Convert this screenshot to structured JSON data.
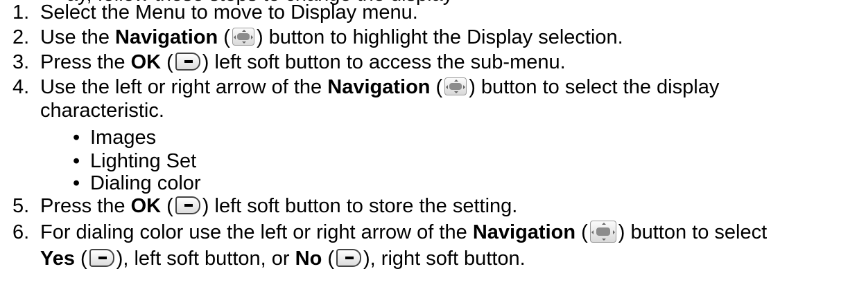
{
  "header_fragment": "ay, follow these steps to change the display",
  "steps": [
    {
      "num": "1.",
      "text": "Select the Menu to move to Display menu."
    },
    {
      "num": "2.",
      "pre": "Use the ",
      "bold": "Navigation",
      "paren_open": " (",
      "paren_close": ") button to highlight the Display selection."
    },
    {
      "num": "3.",
      "pre": "Press the ",
      "bold": "OK",
      "paren_open": " (",
      "paren_close": ") left soft button to access the sub-menu."
    },
    {
      "num": "4.",
      "pre": "Use the left or right arrow of the ",
      "bold": "Navigation",
      "paren_open": " (",
      "paren_close": ") button to select the display",
      "cont": "characteristic."
    },
    {
      "num": "5.",
      "pre": "Press the ",
      "bold": "OK",
      "paren_open": " (",
      "paren_close": ") left soft button to store the setting."
    },
    {
      "num": "6.",
      "pre": "For dialing color use the left or right arrow of the ",
      "bold": "Navigation",
      "paren_open": " (",
      "paren_close": ") button to select",
      "cont_bold1": "Yes",
      "cont_mid1": " (",
      "cont_mid2": "), left soft button, or ",
      "cont_bold2": "No",
      "cont_mid3": " (",
      "cont_end": "), right soft button."
    }
  ],
  "bullets": [
    "Images",
    "Lighting Set",
    "Dialing color"
  ],
  "bullet_symbol": "•",
  "icons": {
    "navigation": "navigation-key-icon",
    "soft": "soft-key-icon"
  }
}
